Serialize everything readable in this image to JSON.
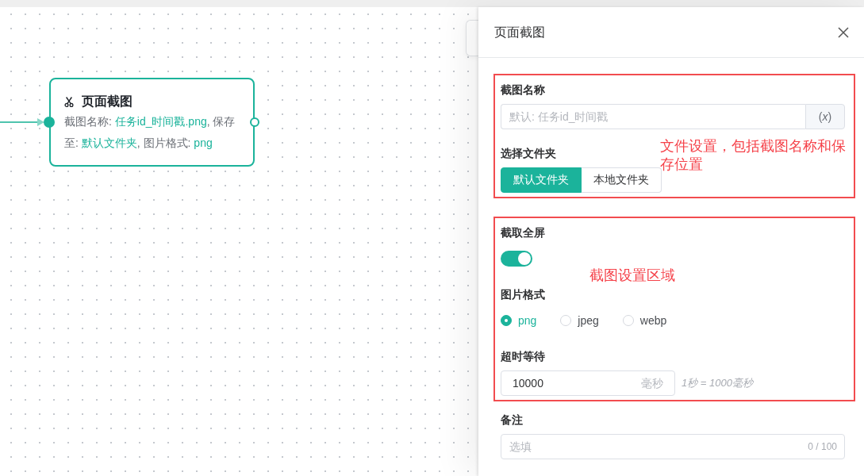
{
  "canvas": {
    "node": {
      "title": "页面截图",
      "description": [
        {
          "kind": "label",
          "text": "截图名称: "
        },
        {
          "kind": "value",
          "text": "任务id_时间戳.png"
        },
        {
          "kind": "label",
          "text": ", 保存至: "
        },
        {
          "kind": "value",
          "text": "默认文件夹"
        },
        {
          "kind": "label",
          "text": ", 图片格式: "
        },
        {
          "kind": "value",
          "text": "png"
        }
      ]
    }
  },
  "drawer": {
    "title": "页面截图",
    "groups": [
      {
        "annotation": "文件设置，包括截图名称和保存位置",
        "fields": [
          {
            "kind": "text",
            "label": "截图名称",
            "placeholder": "默认: 任务id_时间戳",
            "addon": "(*x*)"
          },
          {
            "kind": "segmented",
            "label": "选择文件夹",
            "options": [
              {
                "label": "默认文件夹",
                "selected": true
              },
              {
                "label": "本地文件夹",
                "selected": false
              }
            ]
          }
        ]
      },
      {
        "annotation": "截图设置区域",
        "fields": [
          {
            "kind": "switch",
            "label": "截取全屏",
            "on": true
          },
          {
            "kind": "radio",
            "label": "图片格式",
            "options": [
              {
                "label": "png",
                "selected": true
              },
              {
                "label": "jpeg",
                "selected": false
              },
              {
                "label": "webp",
                "selected": false
              }
            ]
          },
          {
            "kind": "number",
            "label": "超时等待",
            "value": "10000",
            "unit": "毫秒",
            "hint": "1秒 = 1000毫秒"
          }
        ]
      },
      {
        "fields": [
          {
            "kind": "counted",
            "label": "备注",
            "placeholder": "选填",
            "counter": "0 / 100"
          }
        ]
      }
    ]
  }
}
